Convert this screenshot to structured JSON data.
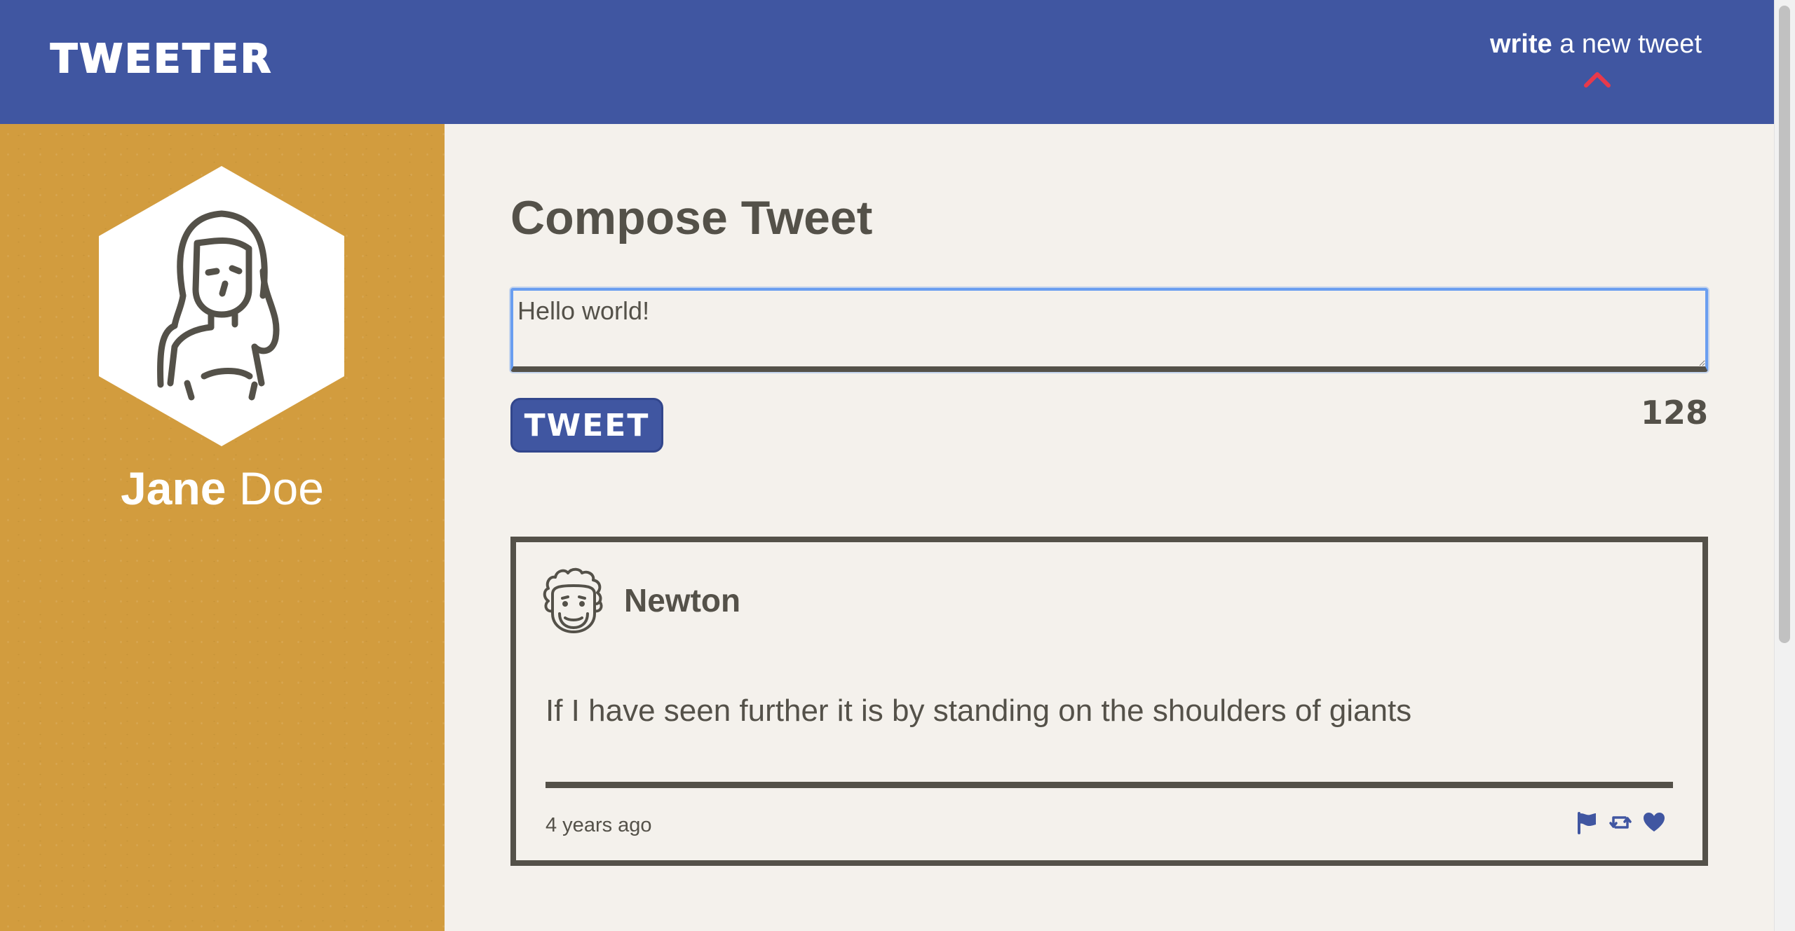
{
  "nav": {
    "brand": "TWEETER",
    "write_link_strong": "write",
    "write_link_rest": " a new tweet"
  },
  "profile": {
    "first_name": "Jane",
    "last_name": " Doe"
  },
  "compose": {
    "title": "Compose Tweet",
    "input_value": "Hello world!",
    "button_label": "TWEET",
    "counter": "128"
  },
  "tweets": [
    {
      "author": "Newton",
      "text": "If I have seen further it is by standing on the shoulders of giants",
      "time": "4 years ago",
      "actions": [
        "flag-icon",
        "retweet-icon",
        "heart-icon"
      ]
    }
  ],
  "colors": {
    "nav_bg": "#4056a1",
    "sidebar_bg": "#d29c3e",
    "page_bg": "#f4f1ec",
    "text": "#545149",
    "caret_accent": "#e8394b",
    "action_icons": "#4056a1",
    "input_focus": "#6a9ef0"
  }
}
